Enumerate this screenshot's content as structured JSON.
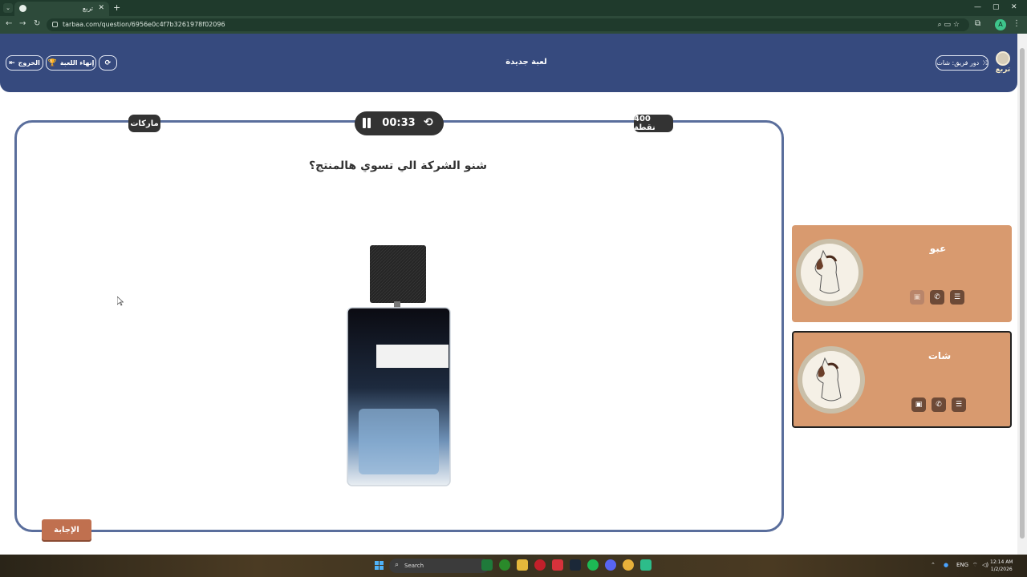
{
  "browser": {
    "tab_title": "تربع",
    "url": "tarbaa.com/question/6956e0c4f7b3261978f02096",
    "profile_initial": "A"
  },
  "header": {
    "title": "لعبة جديدة",
    "exit_label": "الخروج",
    "end_game_label": "إنهاء اللعبة",
    "switch_turn_label": "دور فريق: شات",
    "logo_text": "تربع"
  },
  "question": {
    "category": "ماركات",
    "points": "400 نقطة",
    "timer": "00:33",
    "text": "شنو الشركة الي تسوي هالمنتج؟",
    "answer_label": "الإجابة",
    "image": "perfume-bottle"
  },
  "teams": [
    {
      "name": "عبو",
      "avatar": "horse-avatar",
      "active": false
    },
    {
      "name": "شات",
      "avatar": "horse-avatar",
      "active": true
    }
  ],
  "taskbar": {
    "search_label": "Search",
    "language": "ENG",
    "time": "12:14 AM",
    "date": "1/2/2026"
  },
  "colors": {
    "header": "#364a7e",
    "card_border": "#5a6e9c",
    "team_card": "#d89a6f",
    "answer_button": "#c0704f",
    "pill": "#333333"
  }
}
